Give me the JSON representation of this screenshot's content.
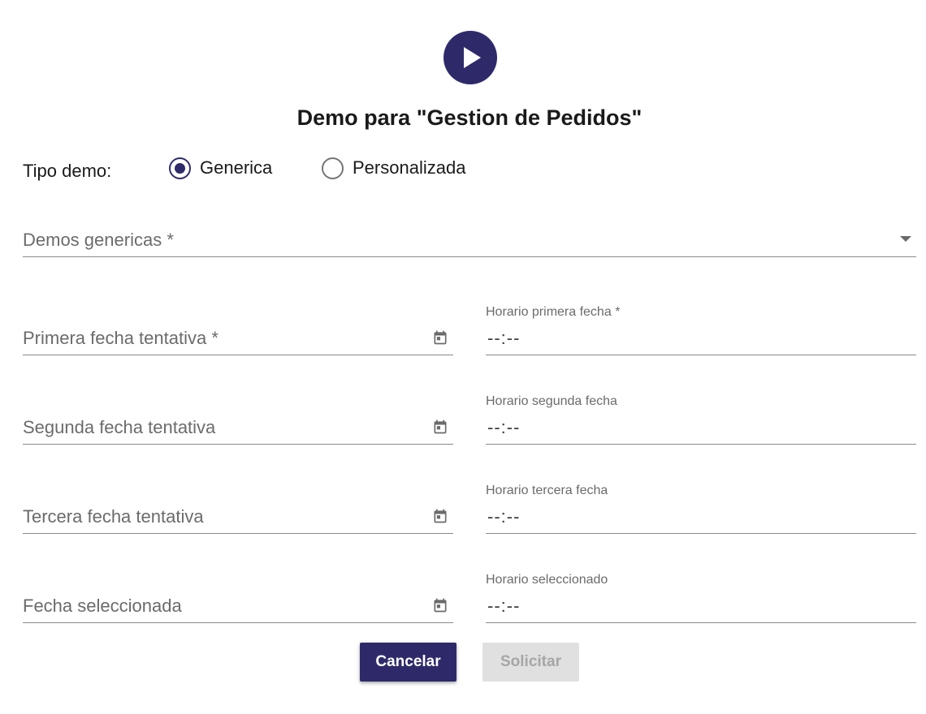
{
  "header": {
    "icon": "play-circle-icon",
    "title": "Demo para \"Gestion de Pedidos\""
  },
  "tipo_demo": {
    "label": "Tipo demo:",
    "options": [
      {
        "label": "Generica",
        "selected": true
      },
      {
        "label": "Personalizada",
        "selected": false
      }
    ]
  },
  "demos_select": {
    "label": "Demos genericas",
    "required_mark": "*",
    "value": ""
  },
  "dates": [
    {
      "label": "Primera fecha tentativa",
      "required_mark": "*",
      "time_label": "Horario primera fecha",
      "time_required_mark": "*",
      "time_value": "--:--"
    },
    {
      "label": "Segunda fecha tentativa",
      "required_mark": "",
      "time_label": "Horario segunda fecha",
      "time_required_mark": "",
      "time_value": "--:--"
    },
    {
      "label": "Tercera fecha tentativa",
      "required_mark": "",
      "time_label": "Horario tercera fecha",
      "time_required_mark": "",
      "time_value": "--:--"
    },
    {
      "label": "Fecha seleccionada",
      "required_mark": "",
      "time_label": "Horario seleccionado",
      "time_required_mark": "",
      "time_value": "--:--"
    }
  ],
  "actions": {
    "cancel_label": "Cancelar",
    "submit_label": "Solicitar",
    "submit_enabled": false
  },
  "colors": {
    "primary": "#2e2a6a",
    "disabled_bg": "#e0e0e0",
    "disabled_text": "#a6a6a6"
  }
}
